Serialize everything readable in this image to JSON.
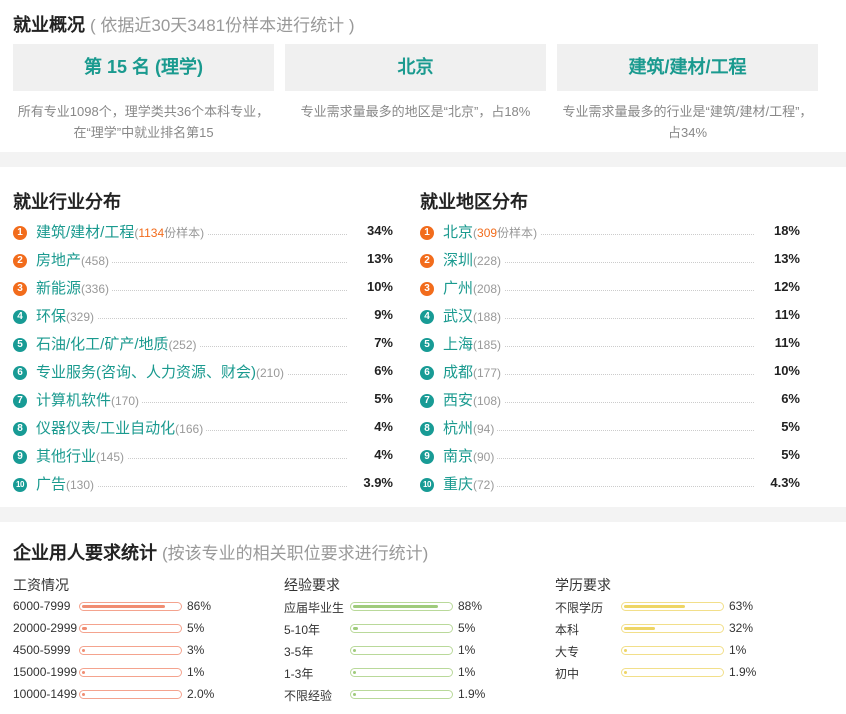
{
  "overview": {
    "title": "就业概况",
    "subtitle": "( 依据近30天3481份样本进行统计 )",
    "cards": [
      {
        "value": "第 15 名 (理学)",
        "note": "所有专业1098个，理学类共36个本科专业，在“理学”中就业排名第15"
      },
      {
        "value": "北京",
        "note": "专业需求量最多的地区是“北京”，占18%"
      },
      {
        "value": "建筑/建材/工程",
        "note": "专业需求量最多的行业是“建筑/建材/工程”，占34%"
      }
    ]
  },
  "industry": {
    "title": "就业行业分布",
    "sample_suffix": "份样本",
    "items": [
      {
        "rank": "1",
        "name": "建筑/建材/工程",
        "count": "1134",
        "pct": "34%"
      },
      {
        "rank": "2",
        "name": "房地产",
        "count": "(458)",
        "pct": "13%"
      },
      {
        "rank": "3",
        "name": "新能源",
        "count": "(336)",
        "pct": "10%"
      },
      {
        "rank": "4",
        "name": "环保",
        "count": "(329)",
        "pct": "9%"
      },
      {
        "rank": "5",
        "name": "石油/化工/矿产/地质",
        "count": "(252)",
        "pct": "7%"
      },
      {
        "rank": "6",
        "name": "专业服务(咨询、人力资源、财会)",
        "count": "(210)",
        "pct": "6%"
      },
      {
        "rank": "7",
        "name": "计算机软件",
        "count": "(170)",
        "pct": "5%"
      },
      {
        "rank": "8",
        "name": "仪器仪表/工业自动化",
        "count": "(166)",
        "pct": "4%"
      },
      {
        "rank": "9",
        "name": "其他行业",
        "count": "(145)",
        "pct": "4%"
      },
      {
        "rank": "10",
        "name": "广告",
        "count": "(130)",
        "pct": "3.9%"
      }
    ]
  },
  "region": {
    "title": "就业地区分布",
    "sample_suffix": "份样本",
    "items": [
      {
        "rank": "1",
        "name": "北京",
        "count": "309",
        "pct": "18%"
      },
      {
        "rank": "2",
        "name": "深圳",
        "count": "(228)",
        "pct": "13%"
      },
      {
        "rank": "3",
        "name": "广州",
        "count": "(208)",
        "pct": "12%"
      },
      {
        "rank": "4",
        "name": "武汉",
        "count": "(188)",
        "pct": "11%"
      },
      {
        "rank": "5",
        "name": "上海",
        "count": "(185)",
        "pct": "11%"
      },
      {
        "rank": "6",
        "name": "成都",
        "count": "(177)",
        "pct": "10%"
      },
      {
        "rank": "7",
        "name": "西安",
        "count": "(108)",
        "pct": "6%"
      },
      {
        "rank": "8",
        "name": "杭州",
        "count": "(94)",
        "pct": "5%"
      },
      {
        "rank": "9",
        "name": "南京",
        "count": "(90)",
        "pct": "5%"
      },
      {
        "rank": "10",
        "name": "重庆",
        "count": "(72)",
        "pct": "4.3%"
      }
    ]
  },
  "requirements": {
    "title": "企业用人要求统计",
    "subtitle": "(按该专业的相关职位要求进行统计)",
    "salary": {
      "title": "工资情况",
      "items": [
        {
          "label": "6000-7999",
          "value": "86%",
          "fraction": 0.86
        },
        {
          "label": "20000-2999",
          "value": "5%",
          "fraction": 0.05
        },
        {
          "label": "4500-5999",
          "value": "3%",
          "fraction": 0.03
        },
        {
          "label": "15000-1999",
          "value": "1%",
          "fraction": 0.01
        },
        {
          "label": "10000-1499",
          "value": "2.0%",
          "fraction": 0.02
        }
      ]
    },
    "experience": {
      "title": "经验要求",
      "items": [
        {
          "label": "应届毕业生",
          "value": "88%",
          "fraction": 0.88
        },
        {
          "label": "5-10年",
          "value": "5%",
          "fraction": 0.05
        },
        {
          "label": "3-5年",
          "value": "1%",
          "fraction": 0.01
        },
        {
          "label": "1-3年",
          "value": "1%",
          "fraction": 0.01
        },
        {
          "label": "不限经验",
          "value": "1.9%",
          "fraction": 0.019
        }
      ]
    },
    "education": {
      "title": "学历要求",
      "items": [
        {
          "label": "不限学历",
          "value": "63%",
          "fraction": 0.63
        },
        {
          "label": "本科",
          "value": "32%",
          "fraction": 0.32
        },
        {
          "label": "大专",
          "value": "1%",
          "fraction": 0.01
        },
        {
          "label": "初中",
          "value": "1.9%",
          "fraction": 0.019
        }
      ]
    }
  }
}
